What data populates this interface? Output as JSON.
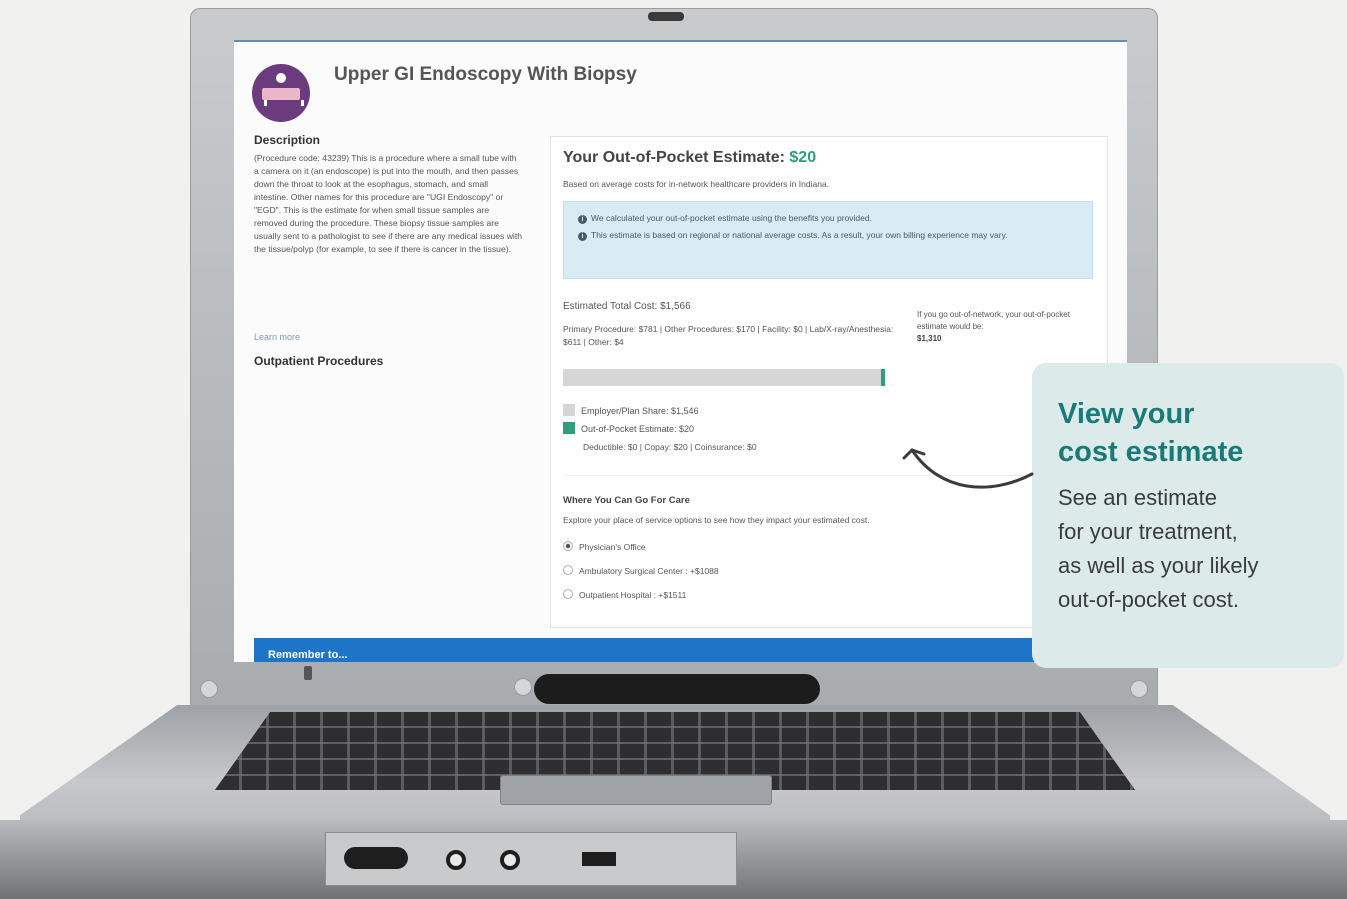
{
  "page": {
    "title": "Upper GI Endoscopy With Biopsy",
    "description_heading": "Description",
    "description": "(Procedure code: 43239) This is a procedure where a small tube with a camera on it (an endoscope) is put into the mouth, and then passes down the throat to look at the esophagus, stomach, and small intestine. Other names for this procedure are \"UGI Endoscopy\" or \"EGD\". This is the estimate for when small tissue samples are removed during the procedure. These biopsy tissue samples are usually sent to a pathologist to see if there are any medical issues with the tissue/polyp (for example, to see if there is cancer in the tissue).",
    "learn_more": "Learn more",
    "outpatient_heading": "Outpatient Procedures"
  },
  "estimate": {
    "title": "Your Out-of-Pocket Estimate: ",
    "amount": "$20",
    "subtitle": "Based on average costs for in-network healthcare providers in Indiana.",
    "info_1": "We calculated your out-of-pocket estimate using the benefits you provided.",
    "info_2": "This estimate is based on regional or national average costs. As a result, your own billing experience may vary.",
    "total": "Estimated Total Cost: $1,566",
    "breakdown": "Primary Procedure: $781  |  Other Procedures: $170  |  Facility: $0  |  Lab/X-ray/Anesthesia: $611  |  Other: $4",
    "oon_text": "If you go out-of-network, your out-of-pocket estimate would be:",
    "oon_amount": "$1,310",
    "out_of_pocket_share": 0.013,
    "legend_employer": "Employer/Plan Share: $1,546",
    "legend_oop": "Out-of-Pocket Estimate: $20",
    "deductible_line": "Deductible: $0  |  Copay: $20  |  Coinsurance: $0",
    "colors": {
      "employer": "#d6d6d6",
      "oop": "#2e9e7c"
    }
  },
  "care": {
    "heading": "Where You Can Go For Care",
    "subtitle": "Explore your place of service options to see how they impact your estimated cost.",
    "options": [
      {
        "label": "Physician's Office",
        "selected": true
      },
      {
        "label": "Ambulatory Surgical Center : +$1088",
        "selected": false
      },
      {
        "label": "Outpatient Hospital : +$1511",
        "selected": false
      }
    ]
  },
  "banner": {
    "text": "Remember to..."
  },
  "callout": {
    "title": "View your\ncost estimate",
    "body": "See an estimate\nfor your treatment,\nas well as your likely\nout-of-pocket cost.",
    "colors": {
      "background": "#dcebea",
      "title": "#1a7a78"
    }
  }
}
